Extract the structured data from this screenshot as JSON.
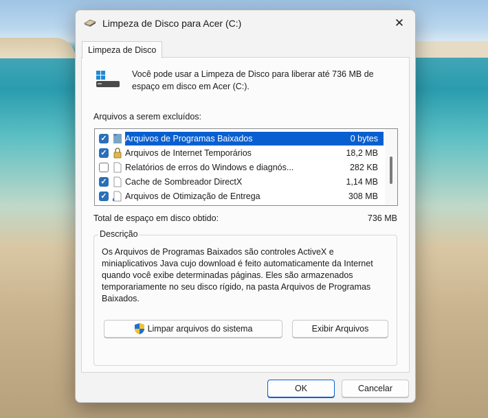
{
  "window": {
    "title": "Limpeza de Disco para Acer (C:)",
    "close_glyph": "✕"
  },
  "tab": {
    "label": "Limpeza de Disco"
  },
  "intro": {
    "text": "Você pode usar a Limpeza de Disco para liberar até 736 MB de espaço em disco em Acer (C:)."
  },
  "files": {
    "label": "Arquivos a serem excluídos:",
    "items": [
      {
        "name": "Arquivos de Programas Baixados",
        "size": "0 bytes",
        "checked": true,
        "selected": true,
        "icon": "folder-icon"
      },
      {
        "name": "Arquivos de Internet Temporários",
        "size": "18,2 MB",
        "checked": true,
        "selected": false,
        "icon": "lock-icon"
      },
      {
        "name": "Relatórios de erros do Windows e diagnós...",
        "size": "282 KB",
        "checked": false,
        "selected": false,
        "icon": "file-icon"
      },
      {
        "name": "Cache de Sombreador DirectX",
        "size": "1,14 MB",
        "checked": true,
        "selected": false,
        "icon": "file-icon"
      },
      {
        "name": "Arquivos de Otimização de Entrega",
        "size": "308 MB",
        "checked": true,
        "selected": false,
        "icon": "file-icon"
      }
    ]
  },
  "total": {
    "label": "Total de espaço em disco obtido:",
    "value": "736 MB"
  },
  "description": {
    "legend": "Descrição",
    "text": "Os Arquivos de Programas Baixados são controles ActiveX e miniaplicativos Java cujo download é feito automaticamente da Internet quando você exibe determinadas páginas. Eles são armazenados temporariamente no seu disco rígido, na pasta Arquivos de Programas Baixados."
  },
  "buttons": {
    "cleanup_system": "Limpar arquivos do sistema",
    "view_files": "Exibir Arquivos",
    "ok": "OK",
    "cancel": "Cancelar"
  },
  "colors": {
    "selection": "#0a5fd0",
    "checkbox": "#2a6fb8"
  }
}
